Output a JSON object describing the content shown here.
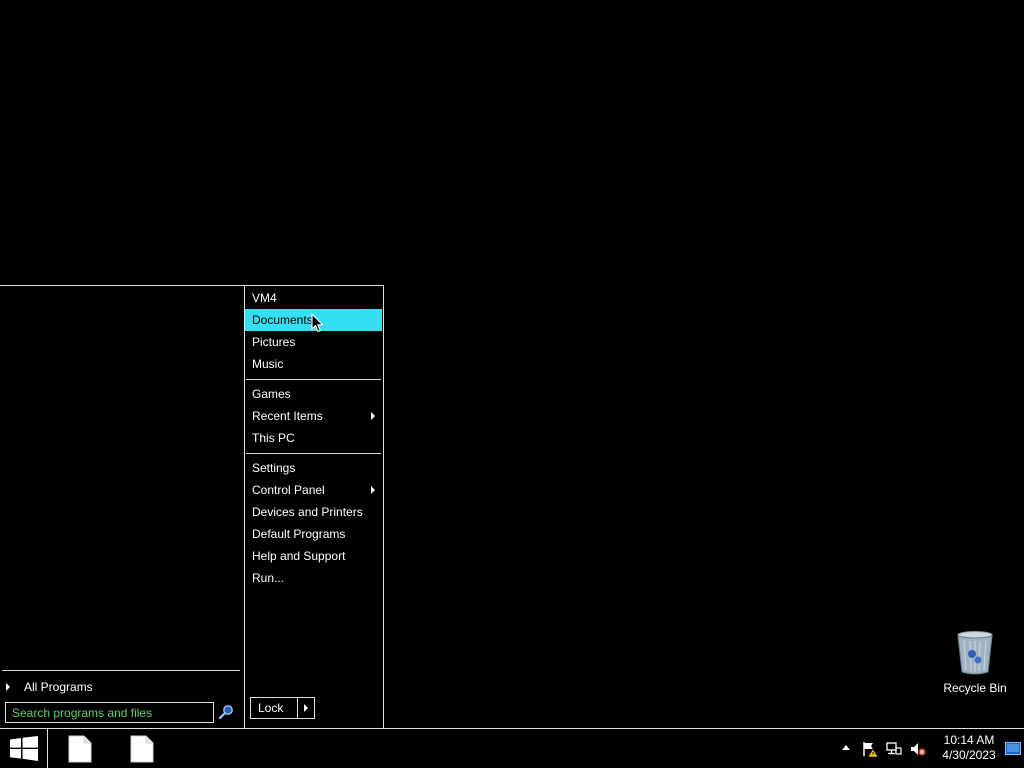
{
  "start_menu": {
    "left_pane": {
      "all_programs_label": "All Programs",
      "search_placeholder": "Search programs and files"
    },
    "right_pane": {
      "items": [
        {
          "label": "VM4"
        },
        {
          "label": "Documents",
          "highlighted": true
        },
        {
          "label": "Pictures"
        },
        {
          "label": "Music"
        },
        {
          "label": "Games"
        },
        {
          "label": "Recent Items",
          "has_submenu": true
        },
        {
          "label": "This PC"
        },
        {
          "label": "Settings"
        },
        {
          "label": "Control Panel",
          "has_submenu": true
        },
        {
          "label": "Devices and Printers"
        },
        {
          "label": "Default Programs"
        },
        {
          "label": "Help and Support"
        },
        {
          "label": "Run..."
        }
      ],
      "lock_label": "Lock"
    }
  },
  "desktop": {
    "recycle_bin_label": "Recycle Bin"
  },
  "taskbar": {
    "apps": [
      {
        "icon": "document-icon"
      },
      {
        "icon": "document-icon"
      }
    ],
    "tray_icons": [
      "show-hidden-icons",
      "action-center-flag-icon",
      "network-icon",
      "volume-muted-icon"
    ],
    "clock": {
      "time": "10:14 AM",
      "date": "4/30/2023"
    }
  },
  "colors": {
    "highlight": "#33e0f2",
    "search_text": "#5fd35f",
    "background": "#000000"
  }
}
